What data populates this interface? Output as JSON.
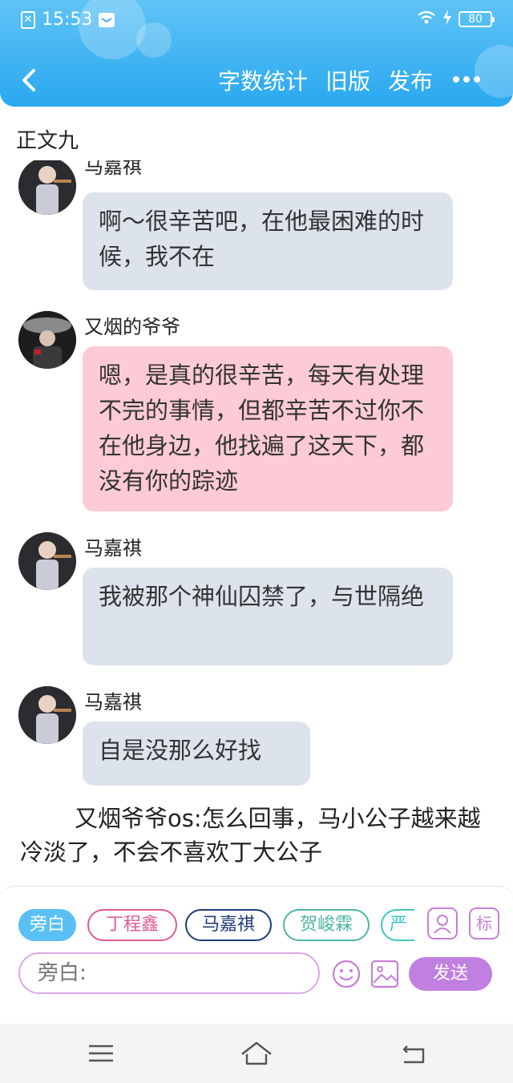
{
  "status_bar": {
    "time": "15:53",
    "battery": "80"
  },
  "nav": {
    "actions": [
      "字数统计",
      "旧版",
      "发布"
    ]
  },
  "chapter_title": "正文九",
  "messages": [
    {
      "sender": "马嘉祺",
      "text": "啊～很辛苦吧，在他最困难的时候，我不在",
      "bubble_color": "#dde3ec"
    },
    {
      "sender": "又烟的爷爷",
      "text": "嗯，是真的很辛苦，每天有处理不完的事情，但都辛苦不过你不在他身边，他找遍了这天下，都没有你的踪迹",
      "bubble_color": "#fdcbd5"
    },
    {
      "sender": "马嘉祺",
      "text": "我被那个神仙囚禁了，与世隔绝",
      "bubble_color": "#dde3ec"
    },
    {
      "sender": "马嘉祺",
      "text": "自是没那么好找",
      "bubble_color": "#dde3ec"
    }
  ],
  "narration": "又烟爷爷os:怎么回事，马小公子越来越冷淡了，不会不喜欢丁大公子",
  "roles": [
    {
      "label": "旁白",
      "color": "#5ac0f3"
    },
    {
      "label": "丁程鑫",
      "color": "#e05a93"
    },
    {
      "label": "马嘉祺",
      "color": "#1e3a7a"
    },
    {
      "label": "贺峻霖",
      "color": "#4fb5a4"
    },
    {
      "label": "严",
      "color": "#3fc6c0"
    }
  ],
  "tools": {
    "tag_label": "标",
    "send_label": "发送"
  },
  "input": {
    "placeholder": "旁白:"
  },
  "icons": [
    "back-arrow-icon",
    "more-icon",
    "wifi-icon",
    "charging-icon",
    "person-card-icon",
    "emoji-icon",
    "image-icon",
    "menu-icon",
    "home-icon",
    "return-icon"
  ]
}
